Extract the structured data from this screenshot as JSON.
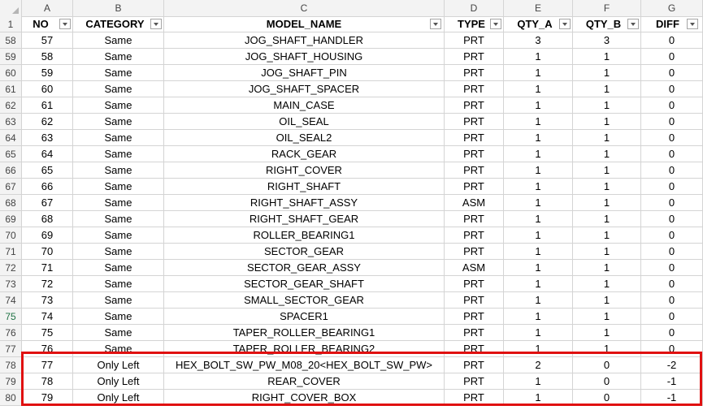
{
  "column_letters": [
    "A",
    "B",
    "C",
    "D",
    "E",
    "F",
    "G"
  ],
  "header_row_number": "1",
  "headers": [
    "NO",
    "CATEGORY",
    "MODEL_NAME",
    "TYPE",
    "QTY_A",
    "QTY_B",
    "DIFF"
  ],
  "active_row": "75",
  "rows": [
    {
      "r": "58",
      "no": "57",
      "cat": "Same",
      "model": "JOG_SHAFT_HANDLER",
      "type": "PRT",
      "qa": "3",
      "qb": "3",
      "diff": "0"
    },
    {
      "r": "59",
      "no": "58",
      "cat": "Same",
      "model": "JOG_SHAFT_HOUSING",
      "type": "PRT",
      "qa": "1",
      "qb": "1",
      "diff": "0"
    },
    {
      "r": "60",
      "no": "59",
      "cat": "Same",
      "model": "JOG_SHAFT_PIN",
      "type": "PRT",
      "qa": "1",
      "qb": "1",
      "diff": "0"
    },
    {
      "r": "61",
      "no": "60",
      "cat": "Same",
      "model": "JOG_SHAFT_SPACER",
      "type": "PRT",
      "qa": "1",
      "qb": "1",
      "diff": "0"
    },
    {
      "r": "62",
      "no": "61",
      "cat": "Same",
      "model": "MAIN_CASE",
      "type": "PRT",
      "qa": "1",
      "qb": "1",
      "diff": "0"
    },
    {
      "r": "63",
      "no": "62",
      "cat": "Same",
      "model": "OIL_SEAL",
      "type": "PRT",
      "qa": "1",
      "qb": "1",
      "diff": "0"
    },
    {
      "r": "64",
      "no": "63",
      "cat": "Same",
      "model": "OIL_SEAL2",
      "type": "PRT",
      "qa": "1",
      "qb": "1",
      "diff": "0"
    },
    {
      "r": "65",
      "no": "64",
      "cat": "Same",
      "model": "RACK_GEAR",
      "type": "PRT",
      "qa": "1",
      "qb": "1",
      "diff": "0"
    },
    {
      "r": "66",
      "no": "65",
      "cat": "Same",
      "model": "RIGHT_COVER",
      "type": "PRT",
      "qa": "1",
      "qb": "1",
      "diff": "0"
    },
    {
      "r": "67",
      "no": "66",
      "cat": "Same",
      "model": "RIGHT_SHAFT",
      "type": "PRT",
      "qa": "1",
      "qb": "1",
      "diff": "0"
    },
    {
      "r": "68",
      "no": "67",
      "cat": "Same",
      "model": "RIGHT_SHAFT_ASSY",
      "type": "ASM",
      "qa": "1",
      "qb": "1",
      "diff": "0"
    },
    {
      "r": "69",
      "no": "68",
      "cat": "Same",
      "model": "RIGHT_SHAFT_GEAR",
      "type": "PRT",
      "qa": "1",
      "qb": "1",
      "diff": "0"
    },
    {
      "r": "70",
      "no": "69",
      "cat": "Same",
      "model": "ROLLER_BEARING1",
      "type": "PRT",
      "qa": "1",
      "qb": "1",
      "diff": "0"
    },
    {
      "r": "71",
      "no": "70",
      "cat": "Same",
      "model": "SECTOR_GEAR",
      "type": "PRT",
      "qa": "1",
      "qb": "1",
      "diff": "0"
    },
    {
      "r": "72",
      "no": "71",
      "cat": "Same",
      "model": "SECTOR_GEAR_ASSY",
      "type": "ASM",
      "qa": "1",
      "qb": "1",
      "diff": "0"
    },
    {
      "r": "73",
      "no": "72",
      "cat": "Same",
      "model": "SECTOR_GEAR_SHAFT",
      "type": "PRT",
      "qa": "1",
      "qb": "1",
      "diff": "0"
    },
    {
      "r": "74",
      "no": "73",
      "cat": "Same",
      "model": "SMALL_SECTOR_GEAR",
      "type": "PRT",
      "qa": "1",
      "qb": "1",
      "diff": "0"
    },
    {
      "r": "75",
      "no": "74",
      "cat": "Same",
      "model": "SPACER1",
      "type": "PRT",
      "qa": "1",
      "qb": "1",
      "diff": "0"
    },
    {
      "r": "76",
      "no": "75",
      "cat": "Same",
      "model": "TAPER_ROLLER_BEARING1",
      "type": "PRT",
      "qa": "1",
      "qb": "1",
      "diff": "0"
    },
    {
      "r": "77",
      "no": "76",
      "cat": "Same",
      "model": "TAPER_ROLLER_BEARING2",
      "type": "PRT",
      "qa": "1",
      "qb": "1",
      "diff": "0"
    },
    {
      "r": "78",
      "no": "77",
      "cat": "Only Left",
      "model": "HEX_BOLT_SW_PW_M08_20<HEX_BOLT_SW_PW>",
      "type": "PRT",
      "qa": "2",
      "qb": "0",
      "diff": "-2"
    },
    {
      "r": "79",
      "no": "78",
      "cat": "Only Left",
      "model": "REAR_COVER",
      "type": "PRT",
      "qa": "1",
      "qb": "0",
      "diff": "-1"
    },
    {
      "r": "80",
      "no": "79",
      "cat": "Only Left",
      "model": "RIGHT_COVER_BOX",
      "type": "PRT",
      "qa": "1",
      "qb": "0",
      "diff": "-1"
    }
  ],
  "highlight_color": "#e01010",
  "filter_icon": "filter-dropdown-icon"
}
